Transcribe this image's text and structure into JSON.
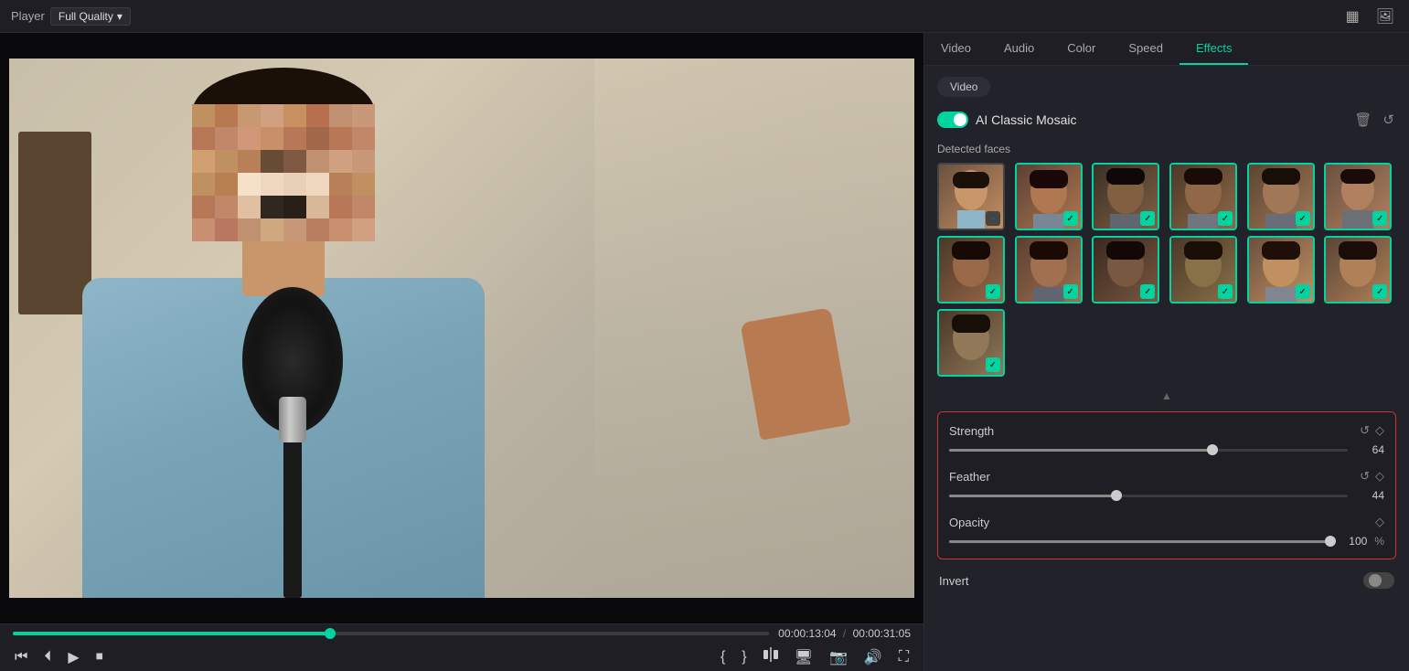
{
  "topbar": {
    "player_label": "Player",
    "quality_label": "Full Quality",
    "icon_grid": "▦",
    "icon_photo": "🖼"
  },
  "tabs": {
    "items": [
      {
        "id": "video",
        "label": "Video",
        "active": false
      },
      {
        "id": "audio",
        "label": "Audio",
        "active": false
      },
      {
        "id": "color",
        "label": "Color",
        "active": false
      },
      {
        "id": "speed",
        "label": "Speed",
        "active": false
      },
      {
        "id": "effects",
        "label": "Effects",
        "active": true
      }
    ]
  },
  "panel": {
    "sub_tab": "Video",
    "effect_name": "AI Classic Mosaic",
    "toggle_on": true,
    "detected_faces_label": "Detected faces",
    "faces": [
      {
        "id": 1,
        "selected": false,
        "bg": "face-bg-1"
      },
      {
        "id": 2,
        "selected": true,
        "bg": "face-bg-2"
      },
      {
        "id": 3,
        "selected": true,
        "bg": "face-bg-3"
      },
      {
        "id": 4,
        "selected": true,
        "bg": "face-bg-4"
      },
      {
        "id": 5,
        "selected": true,
        "bg": "face-bg-5"
      },
      {
        "id": 6,
        "selected": true,
        "bg": "face-bg-6"
      },
      {
        "id": 7,
        "selected": true,
        "bg": "face-bg-7"
      },
      {
        "id": 8,
        "selected": true,
        "bg": "face-bg-8"
      },
      {
        "id": 9,
        "selected": true,
        "bg": "face-bg-9"
      },
      {
        "id": 10,
        "selected": true,
        "bg": "face-bg-10"
      },
      {
        "id": 11,
        "selected": true,
        "bg": "face-bg-11"
      },
      {
        "id": 12,
        "selected": true,
        "bg": "face-bg-12"
      },
      {
        "id": 13,
        "selected": true,
        "bg": "face-bg-13"
      }
    ],
    "strength_label": "Strength",
    "strength_value": "64",
    "strength_pct": 66,
    "feather_label": "Feather",
    "feather_value": "44",
    "feather_pct": 42,
    "opacity_label": "Opacity",
    "opacity_value": "100",
    "opacity_unit": "%",
    "opacity_pct": 100,
    "invert_label": "Invert",
    "invert_on": false
  },
  "timeline": {
    "current_time": "00:00:13:04",
    "total_time": "00:00:31:05",
    "separator": "/",
    "progress_pct": 42
  },
  "controls": {
    "prev": "⏮",
    "step_back": "⏴",
    "play": "▶",
    "stop": "⏹",
    "bracket_open": "{",
    "bracket_close": "}",
    "split": "⚡",
    "monitor": "🖥",
    "camera": "📷",
    "audio": "🔊",
    "fullscreen": "⛶"
  }
}
